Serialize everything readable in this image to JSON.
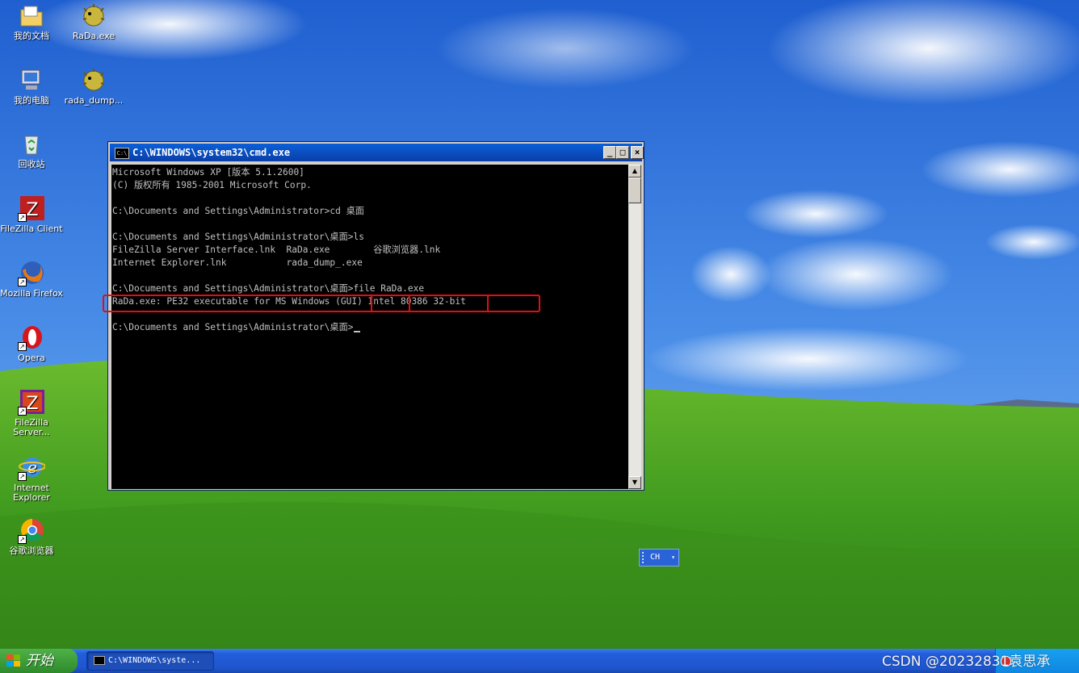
{
  "desktop": {
    "icons": [
      {
        "label": "我的文档"
      },
      {
        "label": "RaDa.exe"
      },
      {
        "label": "我的电脑"
      },
      {
        "label": "rada_dump..."
      },
      {
        "label": "回收站"
      },
      {
        "label": "FileZilla Client"
      },
      {
        "label": "Mozilla Firefox"
      },
      {
        "label": "Opera"
      },
      {
        "label": "FileZilla Server..."
      },
      {
        "label": "Internet Explorer"
      },
      {
        "label": "谷歌浏览器"
      }
    ]
  },
  "cmd_window": {
    "title": "C:\\WINDOWS\\system32\\cmd.exe",
    "title_icon": "C:\\",
    "buttons": {
      "minimize": "_",
      "maximize": "□",
      "close": "×"
    },
    "lines": [
      "Microsoft Windows XP [版本 5.1.2600]",
      "(C) 版权所有 1985-2001 Microsoft Corp.",
      "",
      "C:\\Documents and Settings\\Administrator>cd 桌面",
      "",
      "C:\\Documents and Settings\\Administrator\\桌面>ls",
      "FileZilla Server Interface.lnk  RaDa.exe        谷歌浏览器.lnk",
      "Internet Explorer.lnk           rada_dump_.exe",
      "",
      "C:\\Documents and Settings\\Administrator\\桌面>file RaDa.exe",
      "RaDa.exe: PE32 executable for MS Windows (GUI) Intel 80386 32-bit",
      "",
      "C:\\Documents and Settings\\Administrator\\桌面>"
    ]
  },
  "language_bar": {
    "label": "CH"
  },
  "taskbar": {
    "start_label": "开始",
    "task_label": "C:\\WINDOWS\\syste..."
  },
  "watermark": "CSDN @20232831袁思承",
  "colors": {
    "highlight_box": "#e01010",
    "taskbar_blue": "#245edb",
    "start_green": "#3b9a36"
  }
}
